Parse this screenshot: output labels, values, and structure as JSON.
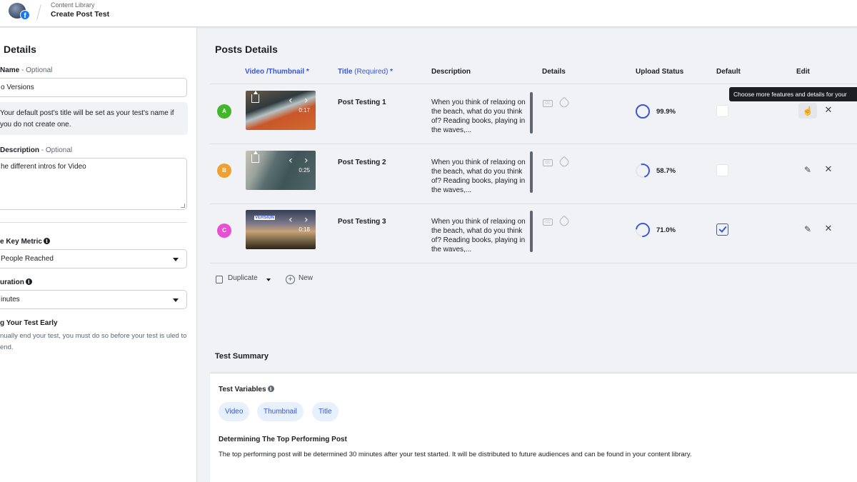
{
  "header": {
    "breadcrumb_parent": "Content Library",
    "page_title": "Create Post Test"
  },
  "left_panel": {
    "title": "Details",
    "name_label": "Name",
    "name_optional": " - Optional",
    "name_value": "o Versions",
    "name_note": "Your default post's title will be set as your test's name if you do not create one.",
    "description_label": "Description",
    "description_optional": " - Optional",
    "description_value": "he different intros for Video",
    "key_metric_label": "e Key Metric",
    "key_metric_value": "People Reached",
    "duration_label": "uration",
    "duration_value": "inutes",
    "end_early_label": "g Your Test Early",
    "end_early_text": "nually end your test, you must do so before your test is uled to end."
  },
  "posts": {
    "title": "Posts Details",
    "columns": {
      "video": "Video /Thumbnail *",
      "title_main": "Title ",
      "title_req": "(Required)",
      "title_star": " *",
      "description": "Description",
      "details": "Details",
      "upload_status": "Upload Status",
      "default": "Default",
      "edit": "Edit"
    },
    "rows": [
      {
        "badge": "A",
        "badge_color": "#42b72a",
        "duration": "0:17",
        "title": "Post Testing 1",
        "description": "When you think of relaxing on the beach, what do you think of? Reading books, playing in the waves,...",
        "upload_pct": "99.9%",
        "progress": 0.999,
        "default": false
      },
      {
        "badge": "B",
        "badge_color": "#f0a030",
        "duration": "0:25",
        "title": "Post Testing 2",
        "description": "When you think of relaxing on the beach, what do you think of? Reading books, playing in the waves,...",
        "upload_pct": "58.7%",
        "progress": 0.587,
        "default": false
      },
      {
        "badge": "C",
        "badge_color": "#e94fd3",
        "duration": "0:18",
        "title": "Post Testing 3",
        "description": "When you think of relaxing on the beach, what do you think of? Reading books, playing in the waves,...",
        "upload_pct": "71.0%",
        "progress": 0.71,
        "default": true
      }
    ],
    "tooltip": "Choose more features and details for your",
    "duplicate_label": "Duplicate",
    "new_label": "New",
    "brand_mark": "VERSION"
  },
  "summary": {
    "title": "Test Summary",
    "variables_label": "Test Variables",
    "variables": [
      "Video",
      "Thumbnail",
      "Title"
    ],
    "top_post_label": "Determining The Top Performing Post",
    "top_post_text": "The top performing post will be determined 30 minutes after your test started. It will be distributed to future audiences and can be found in your content library."
  },
  "colors": {
    "accent": "#3b55d9",
    "pill_bg": "#e7f0fd",
    "page_bg": "#f0f2f5"
  }
}
